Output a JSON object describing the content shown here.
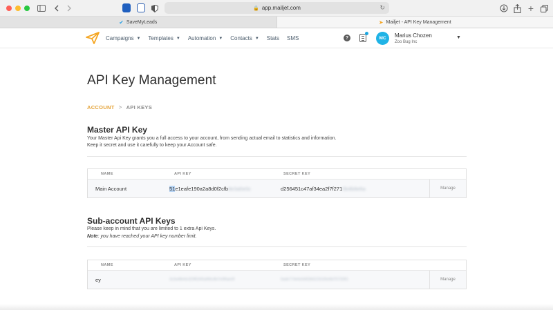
{
  "browser": {
    "url": "app.mailjet.com",
    "tabs": [
      {
        "title": "SaveMyLeads",
        "active": false
      },
      {
        "title": "Mailjet - API Key Management",
        "active": true
      }
    ]
  },
  "nav": {
    "items": [
      {
        "label": "Campaigns",
        "has_dropdown": true
      },
      {
        "label": "Templates",
        "has_dropdown": true
      },
      {
        "label": "Automation",
        "has_dropdown": true
      },
      {
        "label": "Contacts",
        "has_dropdown": true
      },
      {
        "label": "Stats",
        "has_dropdown": false
      },
      {
        "label": "SMS",
        "has_dropdown": false
      }
    ],
    "user": {
      "initials": "MC",
      "name": "Marius Chozen",
      "company": "Zoo Bug Inc"
    }
  },
  "page": {
    "title": "API Key Management",
    "breadcrumb": {
      "parent": "ACCOUNT",
      "separator": ">",
      "current": "API KEYS"
    }
  },
  "master": {
    "title": "Master API Key",
    "desc_line1": "Your Master Api Key grants you a full access to your account, from sending actual email to statistics and information.",
    "desc_line2": "Keep it secret and use it carefully to keep your Account safe.",
    "columns": {
      "name": "NAME",
      "api_key": "API KEY",
      "secret_key": "SECRET KEY"
    },
    "row": {
      "name": "Main Account",
      "api_key_selected": "51",
      "api_key_visible": "e1eafe190a2a8d0f2cfb",
      "api_key_blurred": "8e3a5e0c",
      "secret_key_visible": "d256451c47af34ea2f7f271",
      "secret_key_blurred": "0b4b8e6a",
      "manage": "Manage"
    }
  },
  "sub": {
    "title": "Sub-account API Keys",
    "desc_line1": "Please keep in mind that you are limited to 1 extra Api Keys.",
    "note_label": "Note",
    "note_text": ": you have reached your API key number limit.",
    "columns": {
      "name": "NAME",
      "api_key": "API KEY",
      "secret_key": "SECRET KEY"
    },
    "row": {
      "name": "ey",
      "api_key_blurred": "3c9a48e6e329f5345af96c8b7e0f6ae0f",
      "secret_key_blurred": "5ade774e6e0d53b6219166e8d7572081",
      "manage": "Manage"
    }
  },
  "colors": {
    "accent": "#e4a236",
    "avatar": "#1fb3e6",
    "logo": "#f5a623"
  }
}
